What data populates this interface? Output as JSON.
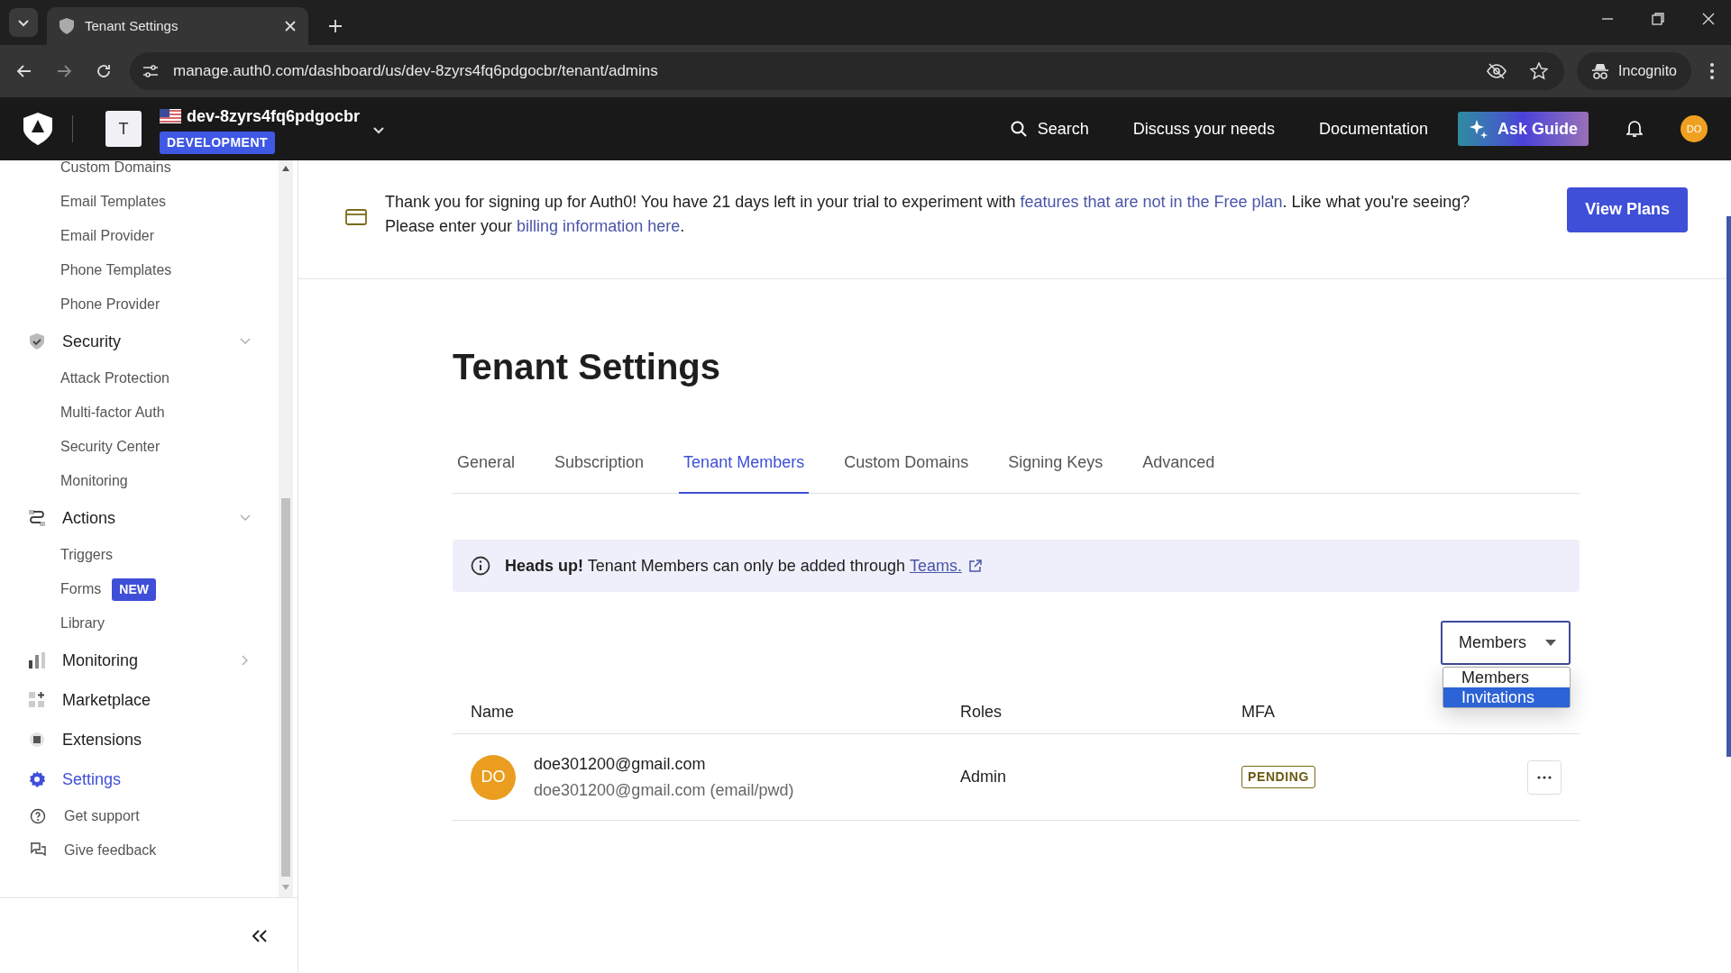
{
  "browser": {
    "tab_title": "Tenant Settings",
    "url": "manage.auth0.com/dashboard/us/dev-8zyrs4fq6pdgocbr/tenant/admins",
    "profile": "Incognito"
  },
  "header": {
    "tenant_initial": "T",
    "tenant_name": "dev-8zyrs4fq6pdgocbr",
    "environment": "DEVELOPMENT",
    "nav": [
      "Search",
      "Discuss your needs",
      "Documentation"
    ],
    "guide_button": "Ask Guide",
    "avatar": "DO"
  },
  "sidebar": {
    "scrolled_items": [
      "Custom Domains",
      "Email Templates",
      "Email Provider",
      "Phone Templates",
      "Phone Provider"
    ],
    "sections": [
      {
        "label": "Security",
        "selected": false,
        "expanded": true,
        "children": [
          {
            "label": "Attack Protection"
          },
          {
            "label": "Multi-factor Auth"
          },
          {
            "label": "Security Center"
          },
          {
            "label": "Monitoring"
          }
        ]
      },
      {
        "label": "Actions",
        "selected": false,
        "expanded": true,
        "children": [
          {
            "label": "Triggers"
          },
          {
            "label": "Forms",
            "badge": "NEW"
          },
          {
            "label": "Library"
          }
        ]
      },
      {
        "label": "Monitoring",
        "selected": false,
        "expanded": false
      },
      {
        "label": "Marketplace",
        "selected": false
      },
      {
        "label": "Extensions",
        "selected": false
      },
      {
        "label": "Settings",
        "selected": true
      }
    ],
    "footer": [
      "Get support",
      "Give feedback"
    ]
  },
  "banner": {
    "parts": [
      {
        "text": "Thank you for signing up for Auth0! You have 21 days left in your trial to experiment with ",
        "link": false
      },
      {
        "text": "features that are not in the Free plan",
        "link": true
      },
      {
        "text": ". Like what you're seeing? Please enter your ",
        "link": false
      },
      {
        "text": "billing information here",
        "link": true
      },
      {
        "text": ".",
        "link": false
      }
    ],
    "button": "View Plans"
  },
  "page": {
    "title": "Tenant Settings",
    "tabs": [
      {
        "label": "General",
        "selected": false
      },
      {
        "label": "Subscription",
        "selected": false
      },
      {
        "label": "Tenant Members",
        "selected": true
      },
      {
        "label": "Custom Domains",
        "selected": false
      },
      {
        "label": "Signing Keys",
        "selected": false
      },
      {
        "label": "Advanced",
        "selected": false
      }
    ],
    "alert": {
      "text": "**Heads up!** Tenant Members can only be added through ",
      "link": "Teams."
    },
    "filter": {
      "value": "Members",
      "open": true,
      "options": [
        {
          "label": "Members",
          "highlighted": false
        },
        {
          "label": "Invitations",
          "highlighted": true
        }
      ]
    },
    "table": {
      "columns": [
        "Name",
        "Roles",
        "MFA"
      ],
      "rows": [
        {
          "avatar": "DO",
          "email": "doe301200@gmail.com",
          "connection": "doe301200@gmail.com (email/pwd)",
          "role": "Admin",
          "mfa": "PENDING"
        }
      ]
    }
  }
}
